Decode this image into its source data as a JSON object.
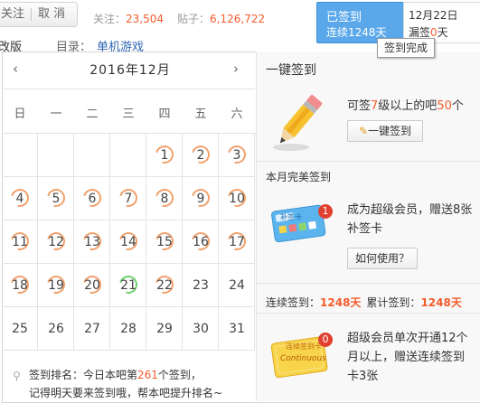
{
  "topbar": {
    "follow_label": "关注",
    "cancel_label": "取 消",
    "follow_count_label": "关注：",
    "follow_count": "23,504",
    "post_count_label": "贴子：",
    "post_count": "6,126,722",
    "revise_label": "改版",
    "catalog_label": "目录：",
    "catalog_value": "单机游戏",
    "signed_label": "已签到",
    "streak_label": "连续1248天",
    "date_label": "12月22日",
    "missed_label": "漏签",
    "missed_count": "0",
    "missed_unit": "天",
    "tooltip": "签到完成"
  },
  "calendar": {
    "title": "2016年12月",
    "prev_icon": "‹",
    "next_icon": "›",
    "weekdays": [
      "日",
      "一",
      "二",
      "三",
      "四",
      "五",
      "六"
    ],
    "days": [
      [
        "",
        "",
        "",
        "",
        "1",
        "2",
        "3"
      ],
      [
        "4",
        "5",
        "6",
        "7",
        "8",
        "9",
        "10"
      ],
      [
        "11",
        "12",
        "13",
        "14",
        "15",
        "16",
        "17"
      ],
      [
        "18",
        "19",
        "20",
        "21",
        "22",
        "23",
        "24"
      ],
      [
        "25",
        "26",
        "27",
        "28",
        "29",
        "30",
        "31"
      ]
    ],
    "signed_days": [
      "1",
      "2",
      "3",
      "4",
      "5",
      "6",
      "7",
      "8",
      "9",
      "10",
      "11",
      "12",
      "13",
      "14",
      "15",
      "16",
      "17",
      "18",
      "19",
      "20",
      "22"
    ],
    "today": "21",
    "rank_prefix": "签到排名：今日本吧第",
    "rank_num": "261",
    "rank_suffix": "个签到，",
    "rank_line2": "记得明天要来签到哦，帮本吧提升排名~"
  },
  "right": {
    "title": "一键签到",
    "onekey_text_1": "可签",
    "onekey_level": "7",
    "onekey_text_2": "级以上的吧",
    "onekey_count": "50",
    "onekey_text_3": "个",
    "onekey_button": "一键签到",
    "perfect_title": "本月完美签到",
    "card_label": "补签卡",
    "card_badge": "1",
    "perfect_text": "成为超级会员，赠送8张补签卡",
    "howto_button": "如何使用？",
    "streak_label": "连续签到：",
    "streak_days": "1248天",
    "total_label": "累计签到：",
    "total_days": "1248天",
    "card2_label": "连续签到卡",
    "card2_sub": "Continuous",
    "card2_badge": "0",
    "card2_text": "超级会员单次开通12个月以上，赠送连续签到卡3张"
  }
}
